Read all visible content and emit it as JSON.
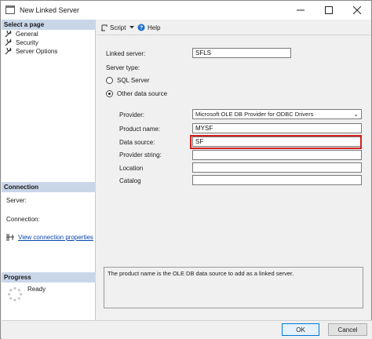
{
  "window": {
    "title": "New Linked Server"
  },
  "left_pane": {
    "select_page_header": "Select a page",
    "pages": [
      {
        "label": "General",
        "icon": "wrench-icon"
      },
      {
        "label": "Security",
        "icon": "wrench-icon"
      },
      {
        "label": "Server Options",
        "icon": "wrench-icon"
      }
    ],
    "connection_header": "Connection",
    "server_label": "Server:",
    "connection_label": "Connection:",
    "view_connection_link": "View connection properties",
    "progress_header": "Progress",
    "progress_status": "Ready"
  },
  "toolbar": {
    "script_label": "Script",
    "help_label": "Help"
  },
  "form": {
    "linked_server_label": "Linked server:",
    "linked_server_value": "SFLS",
    "server_type_label": "Server type:",
    "sql_server_option": "SQL Server",
    "other_source_option": "Other data source",
    "selected_server_type": "Other data source",
    "provider_label": "Provider:",
    "provider_value": "Microsoft OLE DB Provider for ODBC Drivers",
    "product_name_label": "Product name:",
    "product_name_value": "MYSF",
    "data_source_label": "Data source:",
    "data_source_value": "SF",
    "provider_string_label": "Provider string:",
    "provider_string_value": "",
    "location_label": "Location",
    "location_value": "",
    "catalog_label": "Catalog",
    "catalog_value": ""
  },
  "description": "The product name is the OLE DB data source to add as a linked server.",
  "buttons": {
    "ok": "OK",
    "cancel": "Cancel"
  },
  "colors": {
    "highlight": "#d41f1f",
    "link": "#0645ad",
    "section_header": "#c9d6e8"
  }
}
